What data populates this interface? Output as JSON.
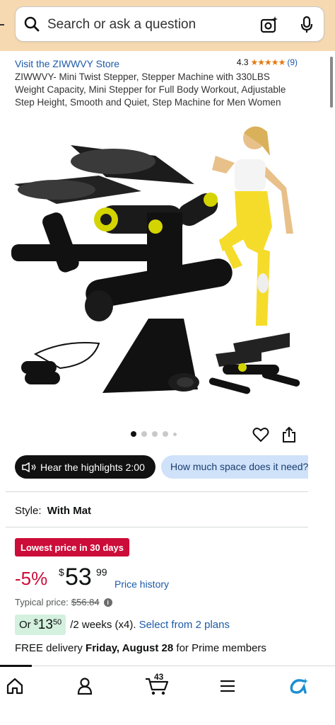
{
  "search": {
    "placeholder": "Search or ask a question"
  },
  "product": {
    "store_link": "Visit the ZIWWVY Store",
    "rating": "4.3",
    "stars": "★★★★★",
    "rating_count": "(9)",
    "title": "ZIWWVY- Mini Twist Stepper, Stepper Machine with 330LBS Weight Capacity, Mini Stepper for Full Body Workout, Adjustable Step Height, Smooth and Quiet, Step Machine for Men Women"
  },
  "gallery": {
    "image_count": 5,
    "active_index": 0
  },
  "actions": {
    "hear_highlights": "Hear the highlights 2:00",
    "ask_chip": "How much space does it need?"
  },
  "style": {
    "label": "Style:",
    "value": "With Mat"
  },
  "pricing": {
    "deal_badge": "Lowest price in 30 days",
    "discount": "-5%",
    "currency": "$",
    "whole": "53",
    "fraction": "99",
    "price_history": "Price history",
    "typical_label": "Typical price:",
    "typical_value": "$56.84",
    "installment_or": "Or",
    "installment_currency": "$",
    "installment_dollars": "13",
    "installment_cents": "50",
    "installment_rest": "/2 weeks (x4).",
    "installment_link": "Select from 2 plans"
  },
  "delivery": {
    "prefix": "FREE delivery",
    "date": "Friday, August 28",
    "suffix": "for Prime members"
  },
  "nav": {
    "cart_count": "43"
  },
  "colors": {
    "accent_bar": "#f6d9b0",
    "link": "#1c5aa8",
    "deal_red": "#cc0c39",
    "chip_blue": "#cfe2fa",
    "plan_green": "#d4f0de"
  }
}
